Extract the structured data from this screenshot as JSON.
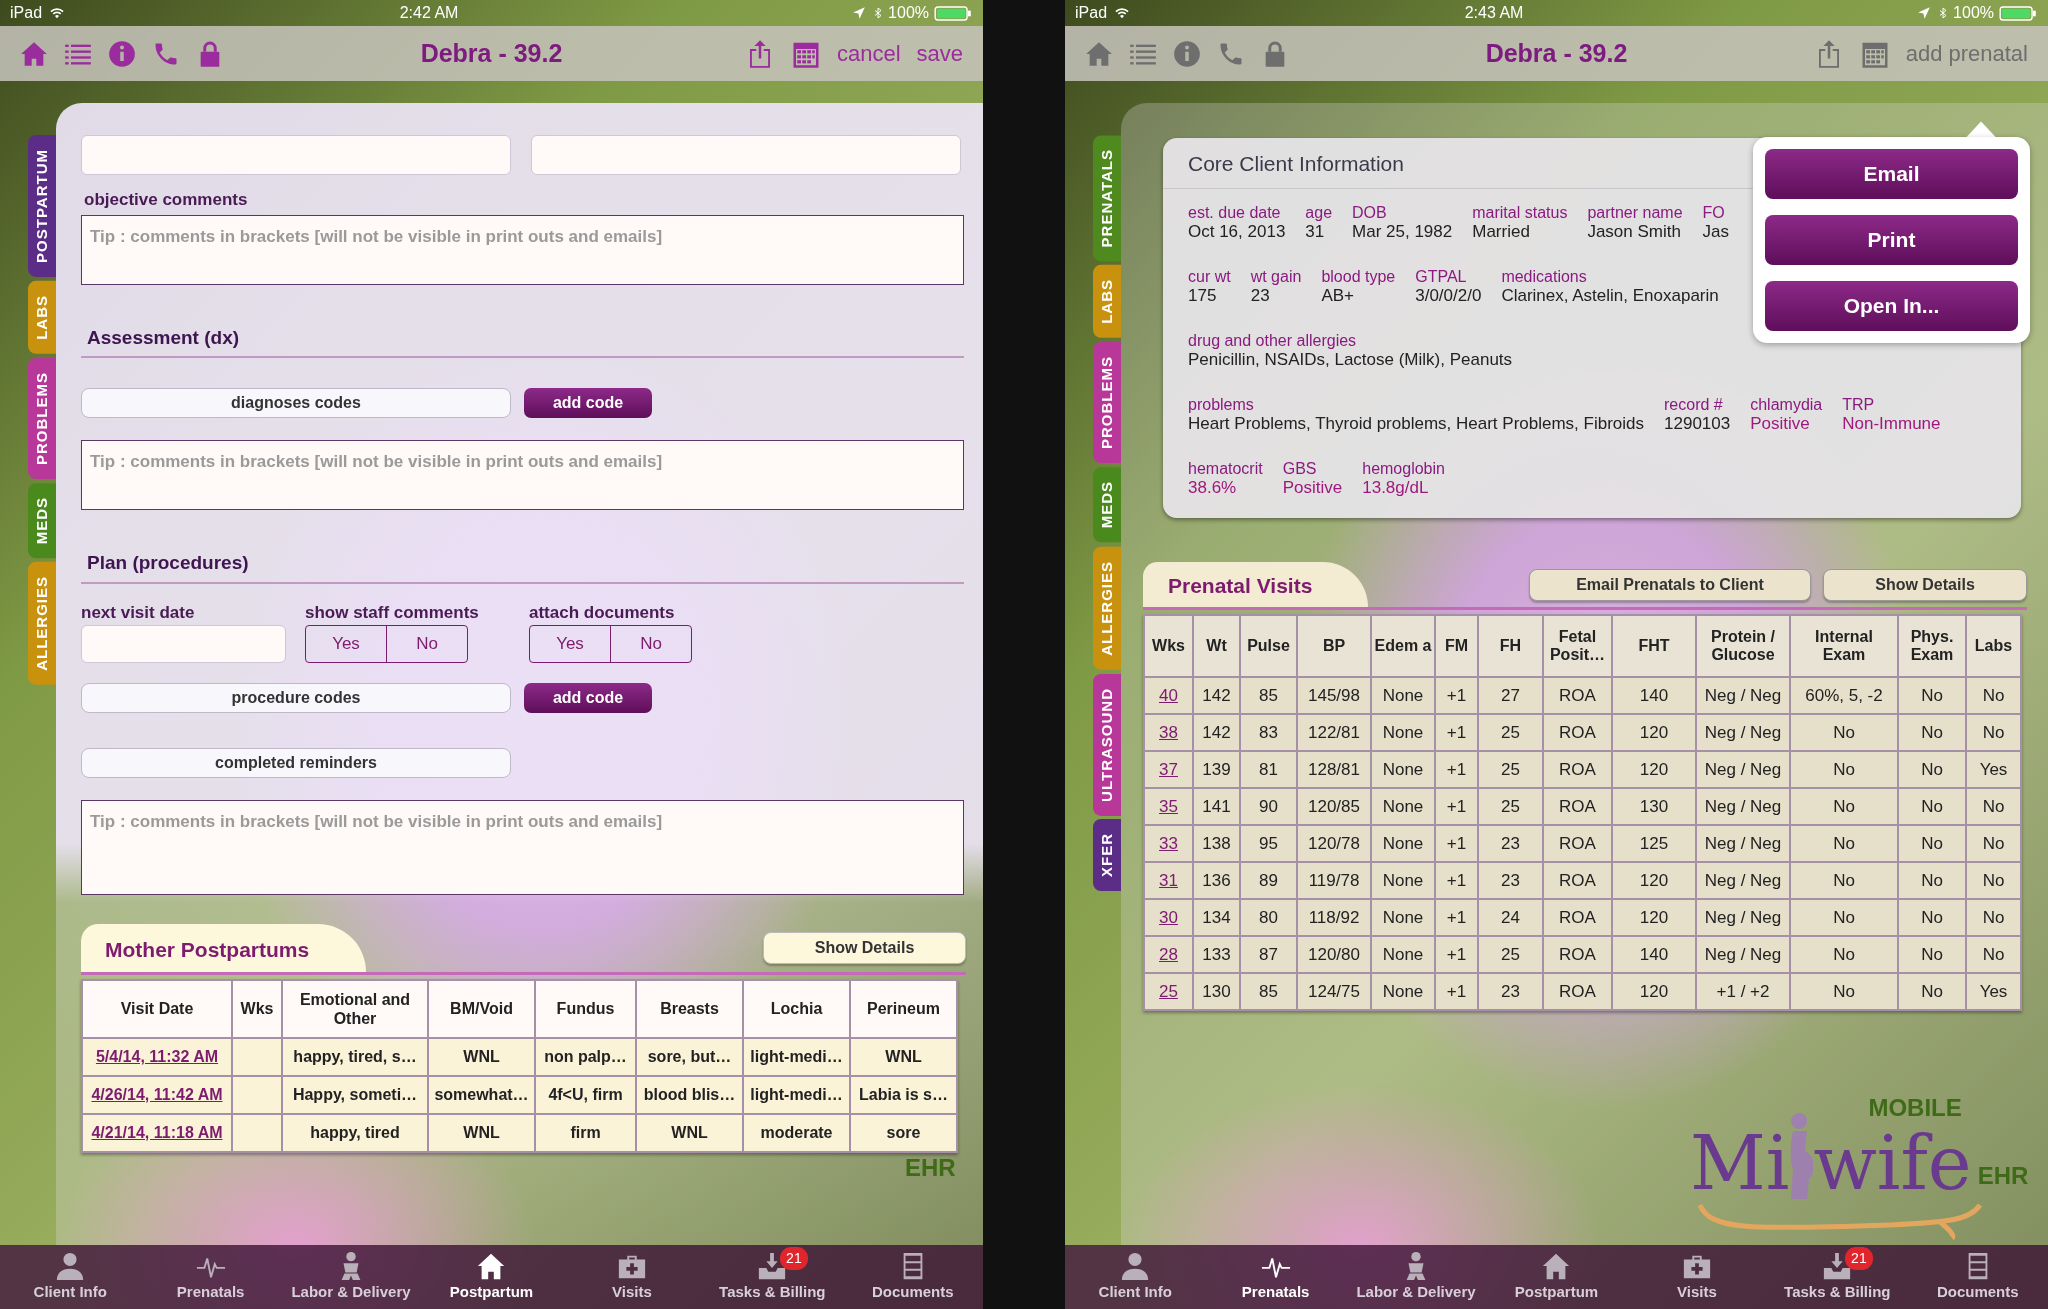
{
  "screens": [
    {
      "kind": "postpartum_form",
      "status_bar": {
        "carrier": "iPad",
        "time": "2:42 AM",
        "battery": "100%"
      },
      "header": {
        "title": "Debra - 39.2",
        "dimmed": false,
        "actions": [
          "cancel",
          "save"
        ]
      },
      "side_tabs": [
        {
          "label": "POSTPARTUM",
          "color": "#5b2d86"
        },
        {
          "label": "LABS",
          "color": "#c8920e"
        },
        {
          "label": "PROBLEMS",
          "color": "#b8389a"
        },
        {
          "label": "MEDS",
          "color": "#4a8a1c"
        },
        {
          "label": "ALLERGIES",
          "color": "#c8920e"
        }
      ],
      "form": {
        "objective_label": "objective comments",
        "objective_placeholder": "Tip : comments in brackets [will not be visible in print outs and emails]",
        "assessment": {
          "heading": "Assessment (dx)",
          "codes_field": "diagnoses codes",
          "add_button": "add code",
          "placeholder": "Tip : comments in brackets [will not be visible in print outs and emails]"
        },
        "plan": {
          "heading": "Plan (procedures)",
          "next_visit_label": "next visit date",
          "toggles": [
            {
              "label": "show staff comments",
              "options": [
                {
                  "label": "Yes",
                  "selected": false
                },
                {
                  "label": "No",
                  "selected": false
                }
              ]
            },
            {
              "label": "attach documents",
              "options": [
                {
                  "label": "Yes",
                  "selected": false
                },
                {
                  "label": "No",
                  "selected": false
                }
              ]
            }
          ],
          "codes_field": "procedure codes",
          "add_button": "add code",
          "reminders_field": "completed reminders",
          "placeholder": "Tip : comments in brackets [will not be visible in print outs and emails]"
        }
      },
      "table": {
        "title": "Mother Postpartums",
        "button": "Show Details",
        "columns": [
          "Visit Date",
          "Wks",
          "Emotional and Other",
          "BM/Void",
          "Fundus",
          "Breasts",
          "Lochia",
          "Perineum"
        ],
        "rows": [
          {
            "visit_date": "5/4/14, 11:32 AM",
            "values": [
              "happy, tired, s…",
              "WNL",
              "non palp…",
              "sore, but…",
              "light-medi…",
              "WNL"
            ]
          },
          {
            "visit_date": "4/26/14, 11:42 AM",
            "values": [
              "Happy, someti…",
              "somewhat…",
              "4f<U, firm",
              "blood blis…",
              "light-medi…",
              "Labia is s…"
            ]
          },
          {
            "visit_date": "4/21/14, 11:18 AM",
            "values": [
              "happy, tired",
              "WNL",
              "firm",
              "WNL",
              "moderate",
              "sore"
            ]
          }
        ]
      },
      "logo": {
        "suffix": "EHR"
      },
      "bottom_tabs": [
        {
          "label": "Client Info",
          "selected": false
        },
        {
          "label": "Prenatals",
          "selected": false
        },
        {
          "label": "Labor & Delivery",
          "selected": false
        },
        {
          "label": "Postpartum",
          "selected": true
        },
        {
          "label": "Visits",
          "selected": false
        },
        {
          "label": "Tasks & Billing",
          "selected": false,
          "badge": "21"
        },
        {
          "label": "Documents",
          "selected": false
        }
      ]
    },
    {
      "kind": "prenatal_overview",
      "status_bar": {
        "carrier": "iPad",
        "time": "2:43 AM",
        "battery": "100%"
      },
      "header": {
        "title": "Debra - 39.2",
        "dimmed": true,
        "actions": [
          "add prenatal"
        ]
      },
      "side_tabs": [
        {
          "label": "PRENATALS",
          "color": "#4f8a1f"
        },
        {
          "label": "LABS",
          "color": "#c8920e"
        },
        {
          "label": "PROBLEMS",
          "color": "#b8389a"
        },
        {
          "label": "MEDS",
          "color": "#4a8a1c"
        },
        {
          "label": "ALLERGIES",
          "color": "#c8920e"
        },
        {
          "label": "ULTRASOUND",
          "color": "#b8389a"
        },
        {
          "label": "XFER",
          "color": "#5b2d86"
        }
      ],
      "core_info": {
        "title": "Core Client Information",
        "rows": [
          {
            "fields": [
              {
                "label": "est. due date",
                "value": "Oct 16, 2013",
                "alert": false
              },
              {
                "label": "age",
                "value": "31",
                "alert": false
              },
              {
                "label": "DOB",
                "value": "Mar 25, 1982",
                "alert": false
              },
              {
                "label": "marital status",
                "value": "Married",
                "alert": false
              },
              {
                "label": "partner name",
                "value": "Jason Smith",
                "alert": false
              },
              {
                "label": "FO",
                "value": "Jas",
                "alert": false
              }
            ]
          },
          {
            "fields": [
              {
                "label": "cur wt",
                "value": "175",
                "alert": false
              },
              {
                "label": "wt gain",
                "value": "23",
                "alert": false
              },
              {
                "label": "blood type",
                "value": "AB+",
                "alert": false
              },
              {
                "label": "GTPAL",
                "value": "3/0/0/2/0",
                "alert": false
              },
              {
                "label": "medications",
                "value": "Clarinex, Astelin, Enoxaparin",
                "alert": false
              }
            ]
          },
          {
            "fields": [
              {
                "label": "drug and other allergies",
                "value": "Penicillin, NSAIDs, Lactose (Milk), Peanuts",
                "alert": false
              }
            ]
          },
          {
            "fields": [
              {
                "label": "problems",
                "value": "Heart Problems, Thyroid problems, Heart Problems, Fibroids",
                "alert": false
              },
              {
                "label": "record #",
                "value": "1290103",
                "alert": false
              },
              {
                "label": "chlamydia",
                "value": "Positive",
                "alert": true
              },
              {
                "label": "TRP",
                "value": "Non-Immune",
                "alert": true
              }
            ]
          },
          {
            "fields": [
              {
                "label": "hematocrit",
                "value": "38.6%",
                "alert": true
              },
              {
                "label": "GBS",
                "value": "Positive",
                "alert": true
              },
              {
                "label": "hemoglobin",
                "value": "13.8g/dL",
                "alert": true
              }
            ]
          }
        ]
      },
      "share_menu": [
        "Email",
        "Print",
        "Open In..."
      ],
      "visits": {
        "title": "Prenatal Visits",
        "buttons": [
          "Email Prenatals to Client",
          "Show Details"
        ],
        "columns": [
          "Wks",
          "Wt",
          "Pulse",
          "BP",
          "Edem a",
          "FM",
          "FH",
          "Fetal Posit…",
          "FHT",
          "Protein / Glucose",
          "Internal Exam",
          "Phys. Exam",
          "Labs"
        ],
        "rows": [
          [
            "40",
            "142",
            "85",
            "145/98",
            "None",
            "+1",
            "27",
            "ROA",
            "140",
            "Neg / Neg",
            "60%, 5, -2",
            "No",
            "No"
          ],
          [
            "38",
            "142",
            "83",
            "122/81",
            "None",
            "+1",
            "25",
            "ROA",
            "120",
            "Neg / Neg",
            "No",
            "No",
            "No"
          ],
          [
            "37",
            "139",
            "81",
            "128/81",
            "None",
            "+1",
            "25",
            "ROA",
            "120",
            "Neg / Neg",
            "No",
            "No",
            "Yes"
          ],
          [
            "35",
            "141",
            "90",
            "120/85",
            "None",
            "+1",
            "25",
            "ROA",
            "130",
            "Neg / Neg",
            "No",
            "No",
            "No"
          ],
          [
            "33",
            "138",
            "95",
            "120/78",
            "None",
            "+1",
            "23",
            "ROA",
            "125",
            "Neg / Neg",
            "No",
            "No",
            "No"
          ],
          [
            "31",
            "136",
            "89",
            "119/78",
            "None",
            "+1",
            "23",
            "ROA",
            "120",
            "Neg / Neg",
            "No",
            "No",
            "No"
          ],
          [
            "30",
            "134",
            "80",
            "118/92",
            "None",
            "+1",
            "24",
            "ROA",
            "120",
            "Neg / Neg",
            "No",
            "No",
            "No"
          ],
          [
            "28",
            "133",
            "87",
            "120/80",
            "None",
            "+1",
            "25",
            "ROA",
            "140",
            "Neg / Neg",
            "No",
            "No",
            "No"
          ],
          [
            "25",
            "130",
            "85",
            "124/75",
            "None",
            "+1",
            "23",
            "ROA",
            "120",
            "+1 / +2",
            "No",
            "No",
            "Yes"
          ]
        ]
      },
      "logo": {
        "top": "MOBILE",
        "word_start": "Mi",
        "word_end": "wife",
        "suffix": "EHR"
      },
      "bottom_tabs": [
        {
          "label": "Client Info",
          "selected": false
        },
        {
          "label": "Prenatals",
          "selected": true
        },
        {
          "label": "Labor & Delivery",
          "selected": false
        },
        {
          "label": "Postpartum",
          "selected": false
        },
        {
          "label": "Visits",
          "selected": false
        },
        {
          "label": "Tasks & Billing",
          "selected": false,
          "badge": "21"
        },
        {
          "label": "Documents",
          "selected": false
        }
      ]
    }
  ]
}
